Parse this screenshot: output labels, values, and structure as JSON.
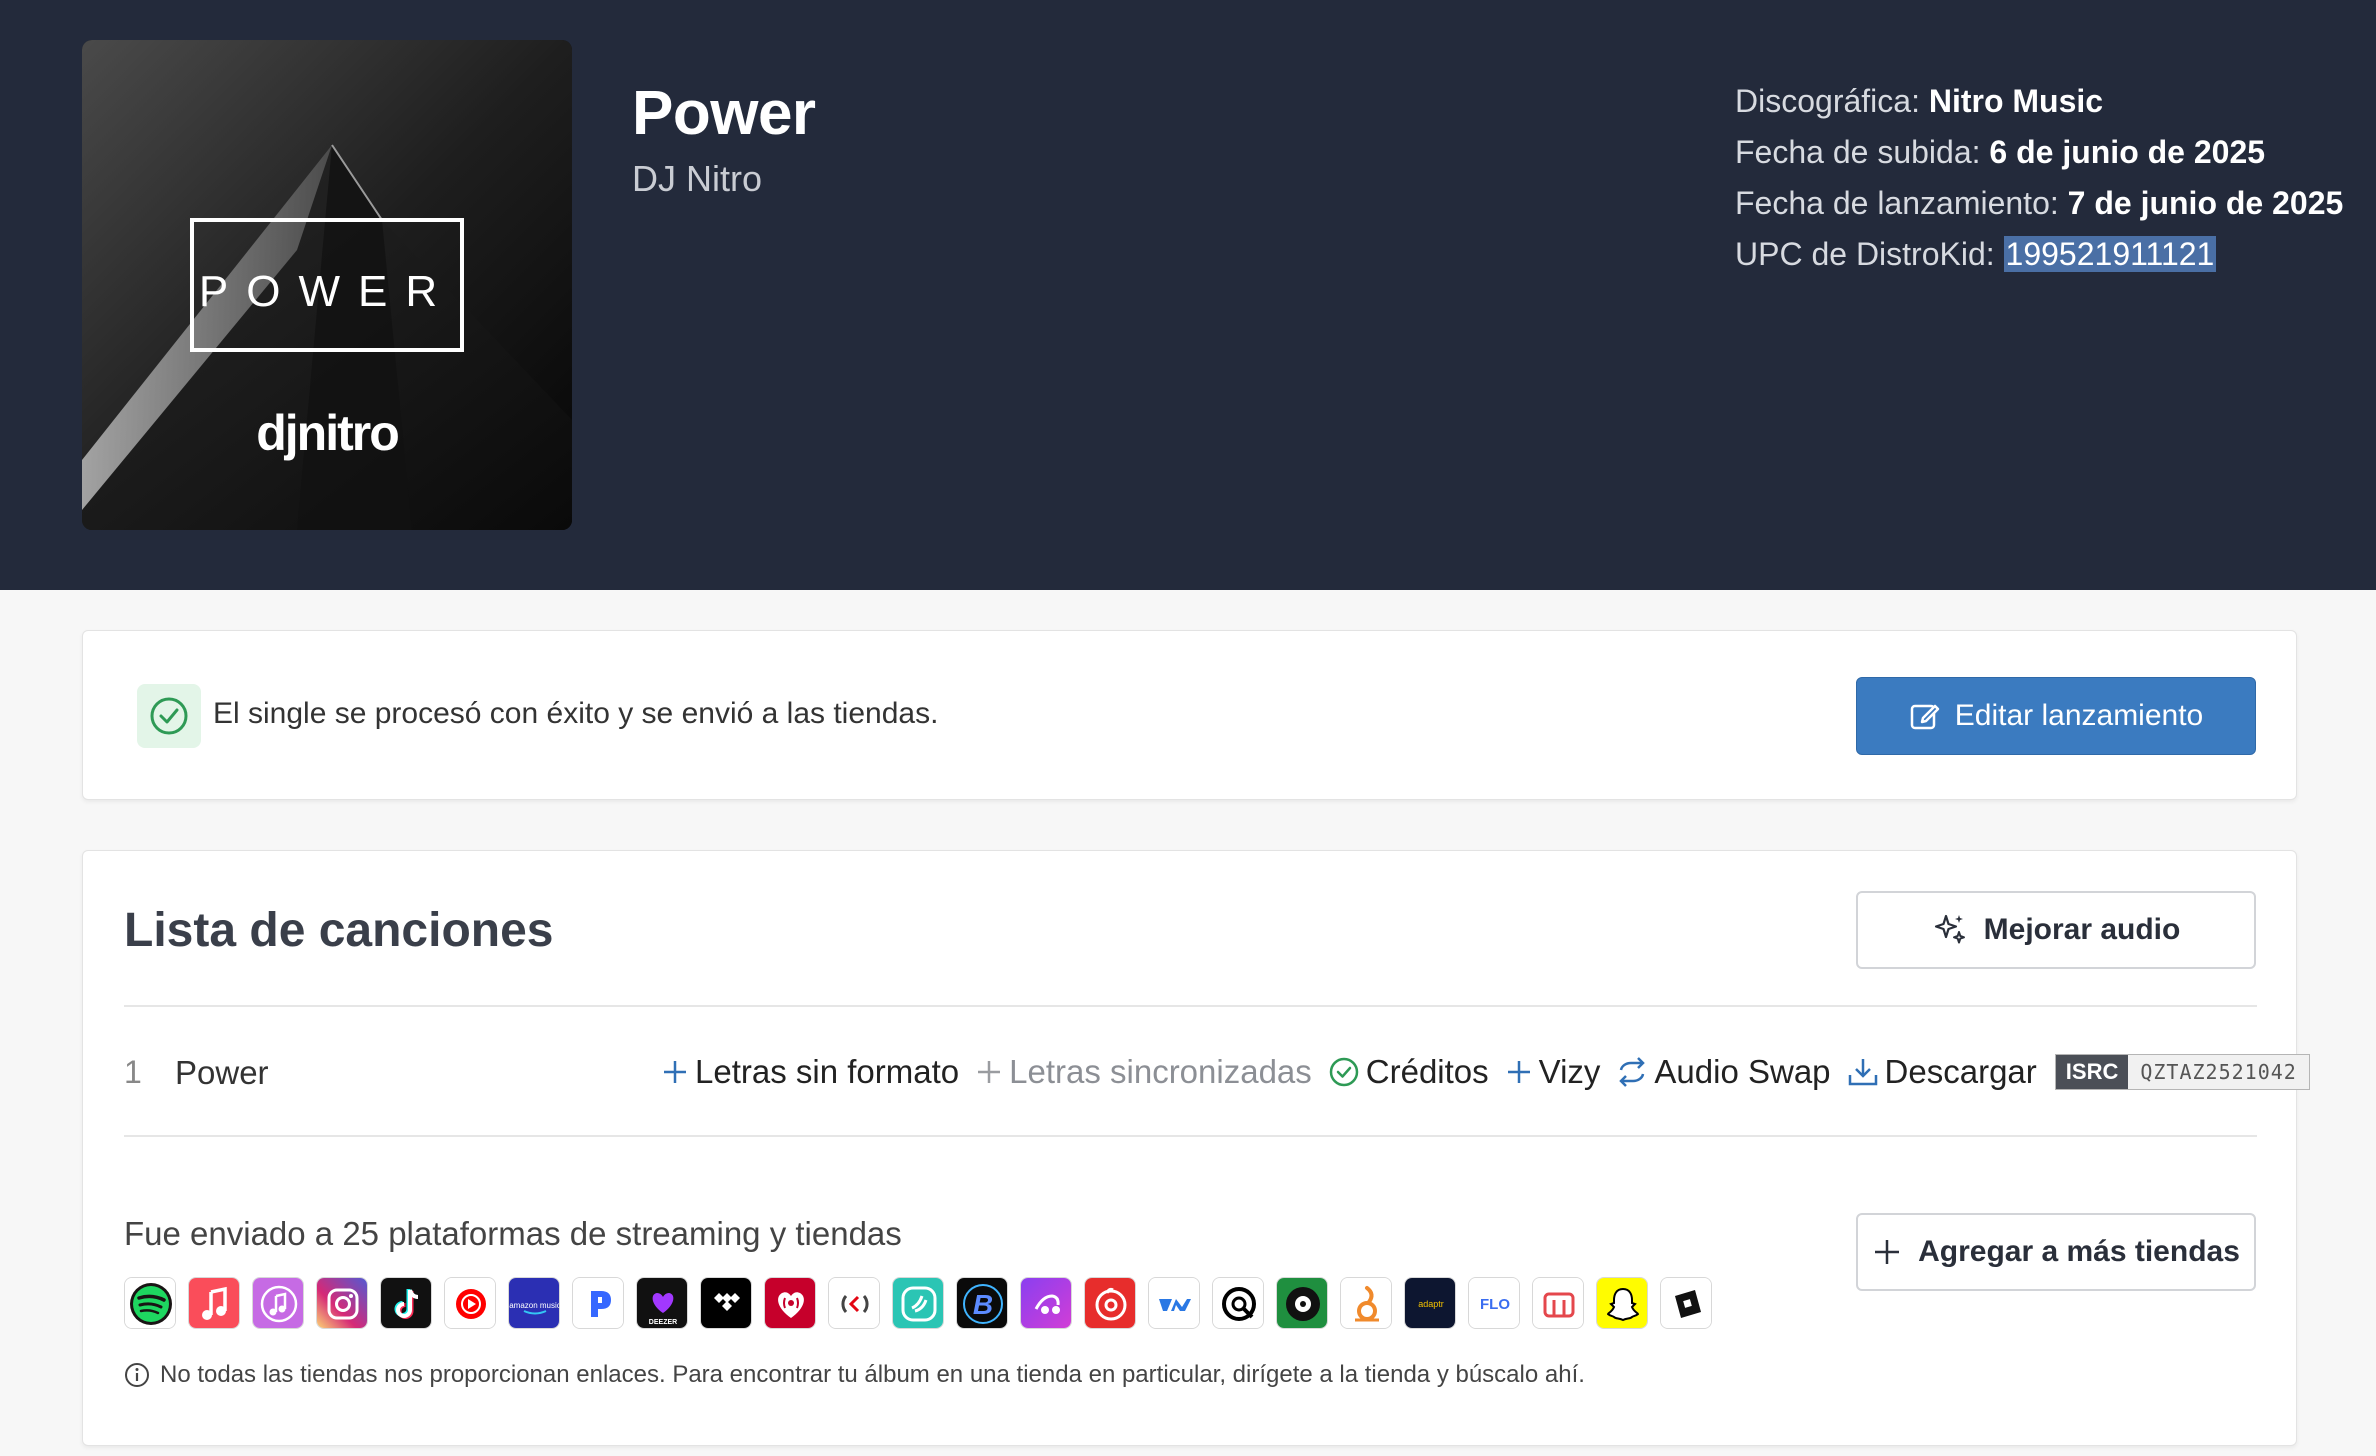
{
  "release": {
    "cover_title": "POWER",
    "cover_artist_logo": "djnitro",
    "title": "Power",
    "artist": "DJ Nitro"
  },
  "meta": {
    "label_key": "Discográfica: ",
    "label_val": "Nitro Music",
    "upload_key": "Fecha de subida: ",
    "upload_val": "6 de junio de 2025",
    "release_key": "Fecha de lanzamiento: ",
    "release_val": "7 de junio de 2025",
    "upc_key": "UPC de DistroKid: ",
    "upc_val": "199521911121"
  },
  "status": {
    "message": "El single se procesó con éxito y se envió a las tiendas.",
    "edit_button": "Editar lanzamiento",
    "success_color": "#2e9a55"
  },
  "tracklist": {
    "title": "Lista de canciones",
    "improve_button": "Mejorar audio",
    "tracks": [
      {
        "number": "1",
        "name": "Power",
        "actions": {
          "plain_lyrics": "Letras sin formato",
          "synced_lyrics": "Letras sincronizadas",
          "credits": "Créditos",
          "vizy": "Vizy",
          "audio_swap": "Audio Swap",
          "download": "Descargar"
        },
        "isrc_label": "ISRC",
        "isrc_code": "QZTAZ2521042"
      }
    ]
  },
  "stores": {
    "sent_text": "Fue enviado a 25 plataformas de streaming y tiendas",
    "add_button": "Agregar a más tiendas",
    "note": "No todas las tiendas nos proporcionan enlaces. Para encontrar tu álbum en una tienda en particular, dirígete a la tienda y búscalo ahí.",
    "icons": [
      "spotify-icon",
      "apple-music-icon",
      "itunes-icon",
      "instagram-icon",
      "tiktok-icon",
      "youtube-music-icon",
      "amazon-music-icon",
      "pandora-icon",
      "deezer-icon",
      "tidal-icon",
      "iheartradio-icon",
      "claro-musica-icon",
      "jiosaavn-icon",
      "boomplay-icon",
      "anghami-icon",
      "netease-icon",
      "tencent-music-icon",
      "qobuz-icon",
      "napster-icon",
      "audiomack-icon",
      "adaptr-icon",
      "flo-icon",
      "melon-icon",
      "snapchat-icon",
      "roblox-icon"
    ],
    "icon_labels": {
      "amazon": "amazon music",
      "deezer": "DEEZER",
      "adaptr": "adaptr",
      "flo": "FLO"
    }
  },
  "colors": {
    "header_bg": "#232a3b",
    "primary": "#3b7bc0",
    "accent_icon": "#2f6fb5"
  }
}
